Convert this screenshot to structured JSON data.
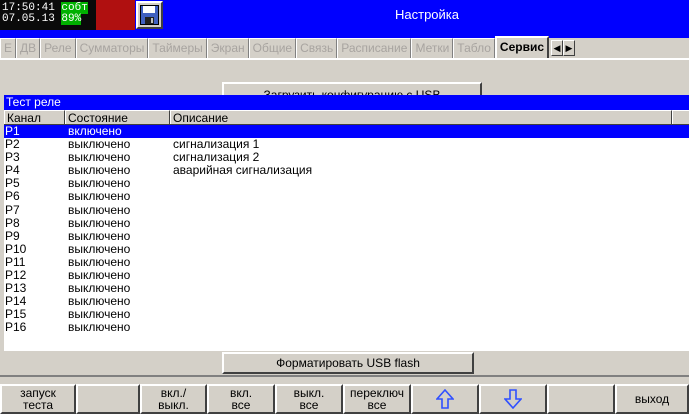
{
  "header": {
    "time": "17:50:41",
    "status": "собт",
    "date": "07.05.13",
    "battery": "89%",
    "title": "Настройка"
  },
  "tabs": [
    {
      "label": "E",
      "active": false
    },
    {
      "label": "ДВ",
      "active": false
    },
    {
      "label": "Реле",
      "active": false
    },
    {
      "label": "Сумматоры",
      "active": false
    },
    {
      "label": "Таймеры",
      "active": false
    },
    {
      "label": "Экран",
      "active": false
    },
    {
      "label": "Общие",
      "active": false
    },
    {
      "label": "Связь",
      "active": false
    },
    {
      "label": "Расписание",
      "active": false
    },
    {
      "label": "Метки",
      "active": false
    },
    {
      "label": "Табло",
      "active": false
    },
    {
      "label": "Сервис",
      "active": true
    }
  ],
  "tab_scroll": {
    "left": "◀",
    "right": "▶"
  },
  "load_config_button": "Загрузить конфигурацию с USB",
  "dialog": {
    "title": "Тест реле",
    "columns": [
      "Канал",
      "Состояние",
      "Описание",
      ""
    ],
    "rows": [
      {
        "channel": "P1",
        "state": "включено",
        "description": ""
      },
      {
        "channel": "P2",
        "state": "выключено",
        "description": "сигнализация 1"
      },
      {
        "channel": "P3",
        "state": "выключено",
        "description": "сигнализация 2"
      },
      {
        "channel": "P4",
        "state": "выключено",
        "description": "аварийная сигнализация"
      },
      {
        "channel": "P5",
        "state": "выключено",
        "description": ""
      },
      {
        "channel": "P6",
        "state": "выключено",
        "description": ""
      },
      {
        "channel": "P7",
        "state": "выключено",
        "description": ""
      },
      {
        "channel": "P8",
        "state": "выключено",
        "description": ""
      },
      {
        "channel": "P9",
        "state": "выключено",
        "description": ""
      },
      {
        "channel": "P10",
        "state": "выключено",
        "description": ""
      },
      {
        "channel": "P11",
        "state": "выключено",
        "description": ""
      },
      {
        "channel": "P12",
        "state": "выключено",
        "description": ""
      },
      {
        "channel": "P13",
        "state": "выключено",
        "description": ""
      },
      {
        "channel": "P14",
        "state": "выключено",
        "description": ""
      },
      {
        "channel": "P15",
        "state": "выключено",
        "description": ""
      },
      {
        "channel": "P16",
        "state": "выключено",
        "description": ""
      }
    ],
    "selected_row": 0
  },
  "format_button": "Форматировать USB flash",
  "function_keys": [
    {
      "line1": "запуск",
      "line2": "теста",
      "icon": null
    },
    {
      "line1": "",
      "line2": "",
      "icon": null
    },
    {
      "line1": "вкл./",
      "line2": "выкл.",
      "icon": null
    },
    {
      "line1": "вкл.",
      "line2": "все",
      "icon": null
    },
    {
      "line1": "выкл.",
      "line2": "все",
      "icon": null
    },
    {
      "line1": "переключ",
      "line2": "все",
      "icon": null
    },
    {
      "line1": "",
      "line2": "",
      "icon": "arrow-up-icon"
    },
    {
      "line1": "",
      "line2": "",
      "icon": "arrow-down-icon"
    },
    {
      "line1": "",
      "line2": "",
      "icon": null
    },
    {
      "line1": "выход",
      "line2": "",
      "icon": null
    }
  ],
  "colors": {
    "header_blue": "#0000ff",
    "selection_blue": "#0000ff",
    "status_green": "#00b000",
    "alarm_red": "#b01010",
    "panel_gray": "#d4d0c8"
  }
}
